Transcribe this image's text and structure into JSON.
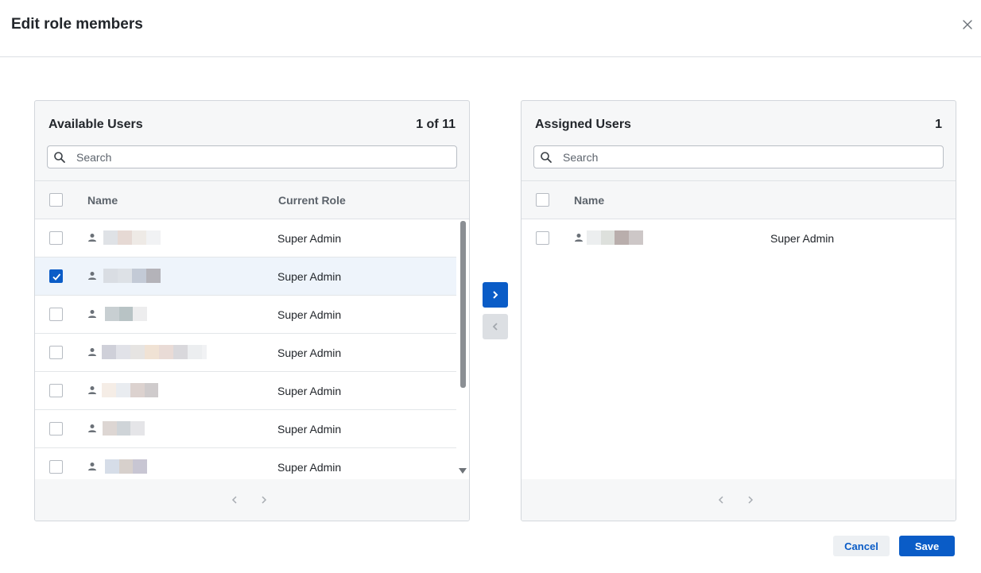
{
  "dialog": {
    "title": "Edit role members",
    "close_icon": "close-icon"
  },
  "available": {
    "title": "Available Users",
    "count": "1 of 11",
    "search_placeholder": "Search",
    "columns": {
      "name": "Name",
      "role": "Current Role"
    },
    "rows": [
      {
        "checked": false,
        "role": "Super Admin"
      },
      {
        "checked": true,
        "role": "Super Admin"
      },
      {
        "checked": false,
        "role": "Super Admin"
      },
      {
        "checked": false,
        "role": "Super Admin"
      },
      {
        "checked": false,
        "role": "Super Admin"
      },
      {
        "checked": false,
        "role": "Super Admin"
      },
      {
        "checked": false,
        "role": "Super Admin"
      }
    ]
  },
  "assigned": {
    "title": "Assigned Users",
    "count": "1",
    "search_placeholder": "Search",
    "columns": {
      "name": "Name"
    },
    "rows": [
      {
        "checked": false,
        "role": "Super Admin"
      }
    ]
  },
  "actions": {
    "cancel_label": "Cancel",
    "save_label": "Save"
  },
  "colors": {
    "accent": "#0a5cc7",
    "disabled": "#dcdfe3",
    "selected_row": "#eef4fb"
  }
}
